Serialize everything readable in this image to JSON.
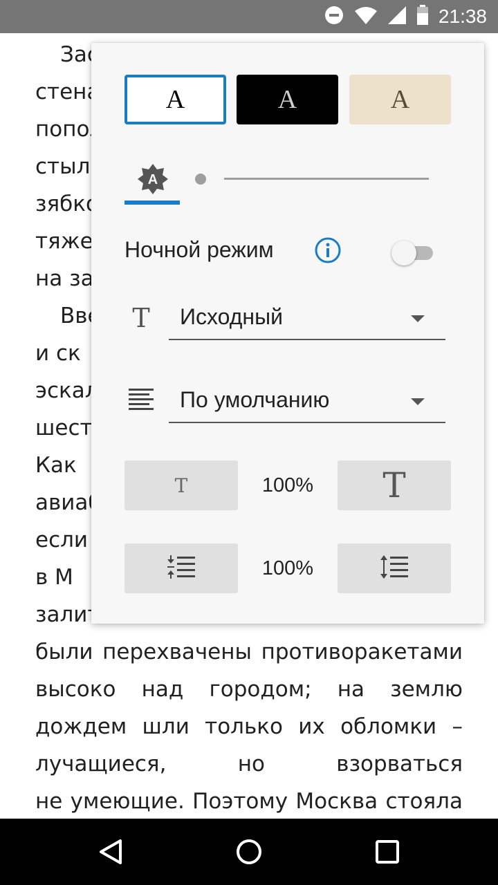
{
  "status_bar": {
    "time": "21:38",
    "icons": [
      "do-not-disturb-icon",
      "wifi-icon",
      "signal-icon",
      "battery-icon"
    ]
  },
  "book": {
    "lines": [
      {
        "text": "Зас",
        "indent": true
      },
      {
        "text": "стена"
      },
      {
        "text": "попол"
      },
      {
        "text": "стыль"
      },
      {
        "text": "зябко"
      },
      {
        "text": "тяжел"
      },
      {
        "text": "на за"
      },
      {
        "text": "Вве",
        "indent": true
      },
      {
        "text": "и  ск"
      },
      {
        "text": "эскал"
      },
      {
        "text": "шесть"
      },
      {
        "text": "Как"
      },
      {
        "text": "авиаб"
      },
      {
        "text": "если"
      },
      {
        "text": "в   М"
      },
      {
        "text": "залитый стеклом. Но боеголовки все",
        "justify": true
      },
      {
        "text": "были перехвачены противоракетами",
        "justify": true
      },
      {
        "text": "высоко над городом; на землю",
        "justify": true
      },
      {
        "text": "дождем шли только их обломки –",
        "justify": true
      },
      {
        "text": "лучащиеся, но взорваться",
        "justify": true
      },
      {
        "text": "не умеющие. Поэтому Москва стояла",
        "justify": true
      }
    ]
  },
  "settings": {
    "themes": [
      {
        "label": "A",
        "name": "white",
        "selected": true
      },
      {
        "label": "A",
        "name": "black",
        "selected": false
      },
      {
        "label": "A",
        "name": "sepia",
        "selected": false
      }
    ],
    "brightness_icon_label": "A",
    "brightness_level": 0,
    "night_mode": {
      "label": "Ночной режим",
      "enabled": false
    },
    "font": {
      "icon_glyph": "T",
      "value": "Исходный"
    },
    "alignment": {
      "value": "По умолчанию"
    },
    "font_size": {
      "small_glyph": "T",
      "large_glyph": "T",
      "value": "100%"
    },
    "line_spacing": {
      "value": "100%"
    }
  },
  "colors": {
    "accent": "#1a7cc2",
    "status_bar": "#757575",
    "panel": "#f7f7f7",
    "sepia": "#ede1cb"
  }
}
